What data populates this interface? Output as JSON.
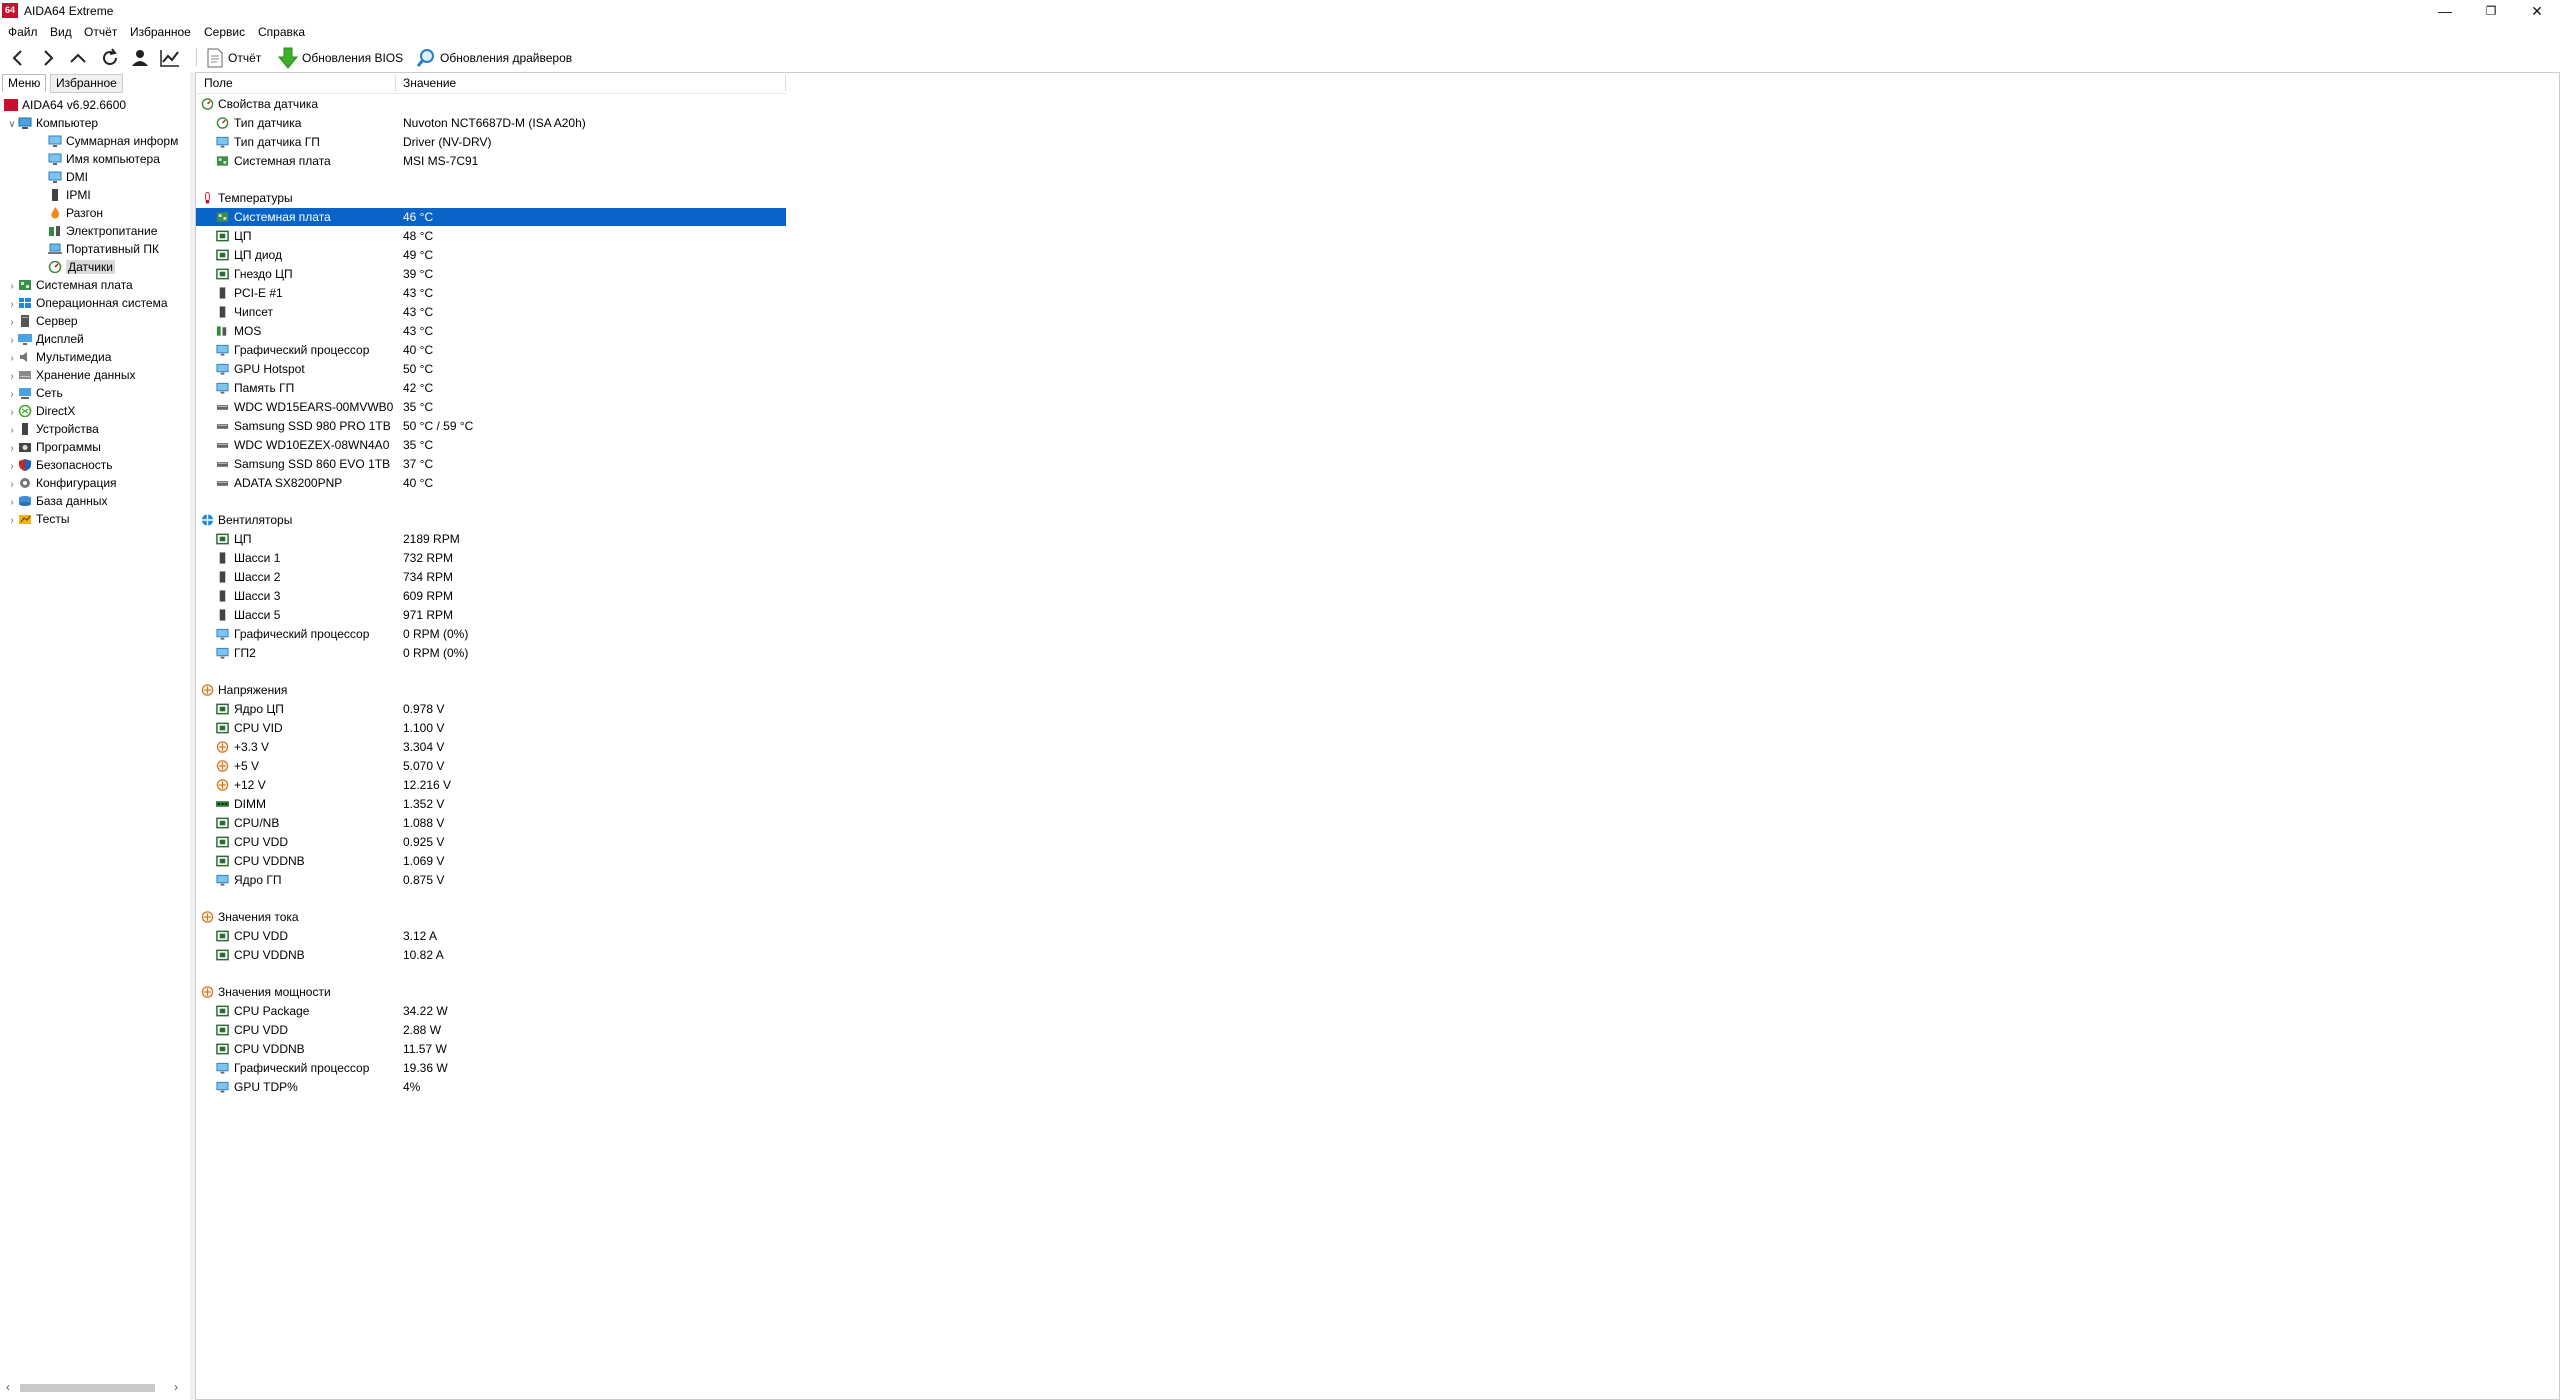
{
  "window": {
    "logo": "64",
    "title": "AIDA64 Extreme",
    "minimize": "—",
    "restore": "❐",
    "close": "✕"
  },
  "menu": [
    "Файл",
    "Вид",
    "Отчёт",
    "Избранное",
    "Сервис",
    "Справка"
  ],
  "toolbar": {
    "report": "Отчёт",
    "bios": "Обновления BIOS",
    "drivers": "Обновления драйверов"
  },
  "tabs": {
    "menu": "Меню",
    "favorites": "Избранное"
  },
  "tree": [
    {
      "label": "AIDA64 v6.92.6600",
      "icon": "aida-logo-icon",
      "level": 0,
      "exp": ""
    },
    {
      "label": "Компьютер",
      "icon": "computer-icon",
      "level": 1,
      "exp": "v"
    },
    {
      "label": "Суммарная информ",
      "icon": "monitor-icon",
      "level": 2,
      "exp": ""
    },
    {
      "label": "Имя компьютера",
      "icon": "monitor-icon",
      "level": 2,
      "exp": ""
    },
    {
      "label": "DMI",
      "icon": "monitor-icon",
      "level": 2,
      "exp": ""
    },
    {
      "label": "IPMI",
      "icon": "device-icon",
      "level": 2,
      "exp": ""
    },
    {
      "label": "Разгон",
      "icon": "flame-icon",
      "level": 2,
      "exp": ""
    },
    {
      "label": "Электропитание",
      "icon": "power-icon",
      "level": 2,
      "exp": ""
    },
    {
      "label": "Портативный ПК",
      "icon": "laptop-icon",
      "level": 2,
      "exp": ""
    },
    {
      "label": "Датчики",
      "icon": "gauge-icon",
      "level": 2,
      "exp": "",
      "selected": true
    },
    {
      "label": "Системная плата",
      "icon": "motherboard-icon",
      "level": 1,
      "exp": ">"
    },
    {
      "label": "Операционная система",
      "icon": "windows-icon",
      "level": 1,
      "exp": ">"
    },
    {
      "label": "Сервер",
      "icon": "server-icon",
      "level": 1,
      "exp": ">"
    },
    {
      "label": "Дисплей",
      "icon": "display-icon",
      "level": 1,
      "exp": ">"
    },
    {
      "label": "Мультимедиа",
      "icon": "speaker-icon",
      "level": 1,
      "exp": ">"
    },
    {
      "label": "Хранение данных",
      "icon": "storage-icon",
      "level": 1,
      "exp": ">"
    },
    {
      "label": "Сеть",
      "icon": "network-icon",
      "level": 1,
      "exp": ">"
    },
    {
      "label": "DirectX",
      "icon": "directx-icon",
      "level": 1,
      "exp": ">"
    },
    {
      "label": "Устройства",
      "icon": "device-icon",
      "level": 1,
      "exp": ">"
    },
    {
      "label": "Программы",
      "icon": "programs-icon",
      "level": 1,
      "exp": ">"
    },
    {
      "label": "Безопасность",
      "icon": "shield-icon",
      "level": 1,
      "exp": ">"
    },
    {
      "label": "Конфигурация",
      "icon": "config-icon",
      "level": 1,
      "exp": ">"
    },
    {
      "label": "База данных",
      "icon": "database-icon",
      "level": 1,
      "exp": ">"
    },
    {
      "label": "Тесты",
      "icon": "benchmark-icon",
      "level": 1,
      "exp": ">"
    }
  ],
  "columns": {
    "field": "Поле",
    "value": "Значение"
  },
  "rows": [
    {
      "type": "group",
      "field": "Свойства датчика",
      "icon": "gauge-icon"
    },
    {
      "field": "Тип датчика",
      "value": "Nuvoton NCT6687D-M  (ISA A20h)",
      "icon": "gauge-icon"
    },
    {
      "field": "Тип датчика ГП",
      "value": "Driver  (NV-DRV)",
      "icon": "monitor-icon"
    },
    {
      "field": "Системная плата",
      "value": "MSI MS-7C91",
      "icon": "motherboard-icon"
    },
    {
      "type": "gap"
    },
    {
      "type": "group",
      "field": "Температуры",
      "icon": "thermometer-icon"
    },
    {
      "field": "Системная плата",
      "value": "46 °C",
      "icon": "motherboard-icon",
      "selected": true
    },
    {
      "field": "ЦП",
      "value": "48 °C",
      "icon": "cpu-icon"
    },
    {
      "field": "ЦП диод",
      "value": "49 °C",
      "icon": "cpu-icon"
    },
    {
      "field": "Гнездо ЦП",
      "value": "39 °C",
      "icon": "cpu-icon"
    },
    {
      "field": "PCI-E #1",
      "value": "43 °C",
      "icon": "device-icon"
    },
    {
      "field": "Чипсет",
      "value": "43 °C",
      "icon": "device-icon"
    },
    {
      "field": "MOS",
      "value": "43 °C",
      "icon": "mos-icon"
    },
    {
      "field": "Графический процессор",
      "value": "40 °C",
      "icon": "monitor-icon"
    },
    {
      "field": "GPU Hotspot",
      "value": "50 °C",
      "icon": "monitor-icon"
    },
    {
      "field": "Память ГП",
      "value": "42 °C",
      "icon": "monitor-icon"
    },
    {
      "field": "WDC WD15EARS-00MVWB0",
      "value": "35 °C",
      "icon": "disk-icon"
    },
    {
      "field": "Samsung SSD 980 PRO 1TB",
      "value": "50 °C / 59 °C",
      "icon": "disk-icon"
    },
    {
      "field": "WDC WD10EZEX-08WN4A0",
      "value": "35 °C",
      "icon": "disk-icon"
    },
    {
      "field": "Samsung SSD 860 EVO 1TB",
      "value": "37 °C",
      "icon": "disk-icon"
    },
    {
      "field": "ADATA SX8200PNP",
      "value": "40 °C",
      "icon": "disk-icon"
    },
    {
      "type": "gap"
    },
    {
      "type": "group",
      "field": "Вентиляторы",
      "icon": "fan-icon"
    },
    {
      "field": "ЦП",
      "value": "2189 RPM",
      "icon": "cpu-icon"
    },
    {
      "field": "Шасси 1",
      "value": "732 RPM",
      "icon": "device-icon"
    },
    {
      "field": "Шасси 2",
      "value": "734 RPM",
      "icon": "device-icon"
    },
    {
      "field": "Шасси 3",
      "value": "609 RPM",
      "icon": "device-icon"
    },
    {
      "field": "Шасси 5",
      "value": "971 RPM",
      "icon": "device-icon"
    },
    {
      "field": "Графический процессор",
      "value": "0 RPM  (0%)",
      "icon": "monitor-icon"
    },
    {
      "field": "ГП2",
      "value": "0 RPM  (0%)",
      "icon": "monitor-icon"
    },
    {
      "type": "gap"
    },
    {
      "type": "group",
      "field": "Напряжения",
      "icon": "voltage-icon"
    },
    {
      "field": "Ядро ЦП",
      "value": "0.978 V",
      "icon": "cpu-icon"
    },
    {
      "field": "CPU VID",
      "value": "1.100 V",
      "icon": "cpu-icon"
    },
    {
      "field": "+3.3 V",
      "value": "3.304 V",
      "icon": "voltage-icon"
    },
    {
      "field": "+5 V",
      "value": "5.070 V",
      "icon": "voltage-icon"
    },
    {
      "field": "+12 V",
      "value": "12.216 V",
      "icon": "voltage-icon"
    },
    {
      "field": "DIMM",
      "value": "1.352 V",
      "icon": "dimm-icon"
    },
    {
      "field": "CPU/NB",
      "value": "1.088 V",
      "icon": "cpu-icon"
    },
    {
      "field": "CPU VDD",
      "value": "0.925 V",
      "icon": "cpu-icon"
    },
    {
      "field": "CPU VDDNB",
      "value": "1.069 V",
      "icon": "cpu-icon"
    },
    {
      "field": "Ядро ГП",
      "value": "0.875 V",
      "icon": "monitor-icon"
    },
    {
      "type": "gap"
    },
    {
      "type": "group",
      "field": "Значения тока",
      "icon": "voltage-icon"
    },
    {
      "field": "CPU VDD",
      "value": "3.12 A",
      "icon": "cpu-icon"
    },
    {
      "field": "CPU VDDNB",
      "value": "10.82 A",
      "icon": "cpu-icon"
    },
    {
      "type": "gap"
    },
    {
      "type": "group",
      "field": "Значения мощности",
      "icon": "voltage-icon"
    },
    {
      "field": "CPU Package",
      "value": "34.22 W",
      "icon": "cpu-icon"
    },
    {
      "field": "CPU VDD",
      "value": "2.88 W",
      "icon": "cpu-icon"
    },
    {
      "field": "CPU VDDNB",
      "value": "11.57 W",
      "icon": "cpu-icon"
    },
    {
      "field": "Графический процессор",
      "value": "19.36 W",
      "icon": "monitor-icon"
    },
    {
      "field": "GPU TDP%",
      "value": "4%",
      "icon": "monitor-icon"
    }
  ]
}
